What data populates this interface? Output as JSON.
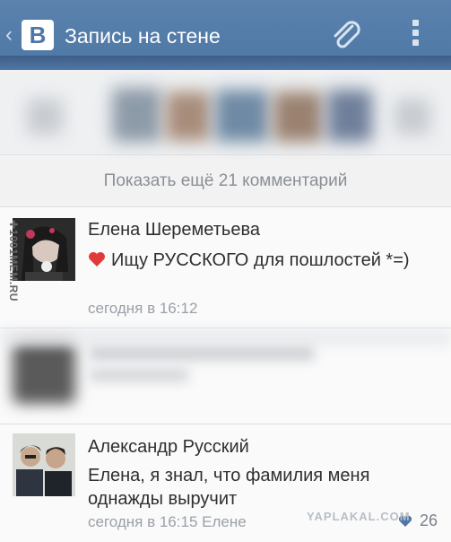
{
  "header": {
    "back_glyph": "‹",
    "logo_letter": "B",
    "title": "Запись на стене",
    "attach_icon": "paperclip-icon",
    "menu_icon": "overflow-menu-icon",
    "background": "#4d77a6"
  },
  "show_more": "Показать ещё 21 комментарий",
  "comments": [
    {
      "author": "Елена Шереметьева",
      "text": "Ищу РУССКОГО для пошлостей *=)",
      "emoji": "heart-icon",
      "time": "сегодня в 16:12"
    },
    {
      "author": "Александр Русский",
      "text": "Елена, я знал, что фамилия меня однажды выручит",
      "time": "сегодня в 16:15 Елене",
      "likes": "26"
    }
  ],
  "watermarks": {
    "left": "✚1001MEM.RU",
    "right": "YAPLAKAL.COM"
  }
}
